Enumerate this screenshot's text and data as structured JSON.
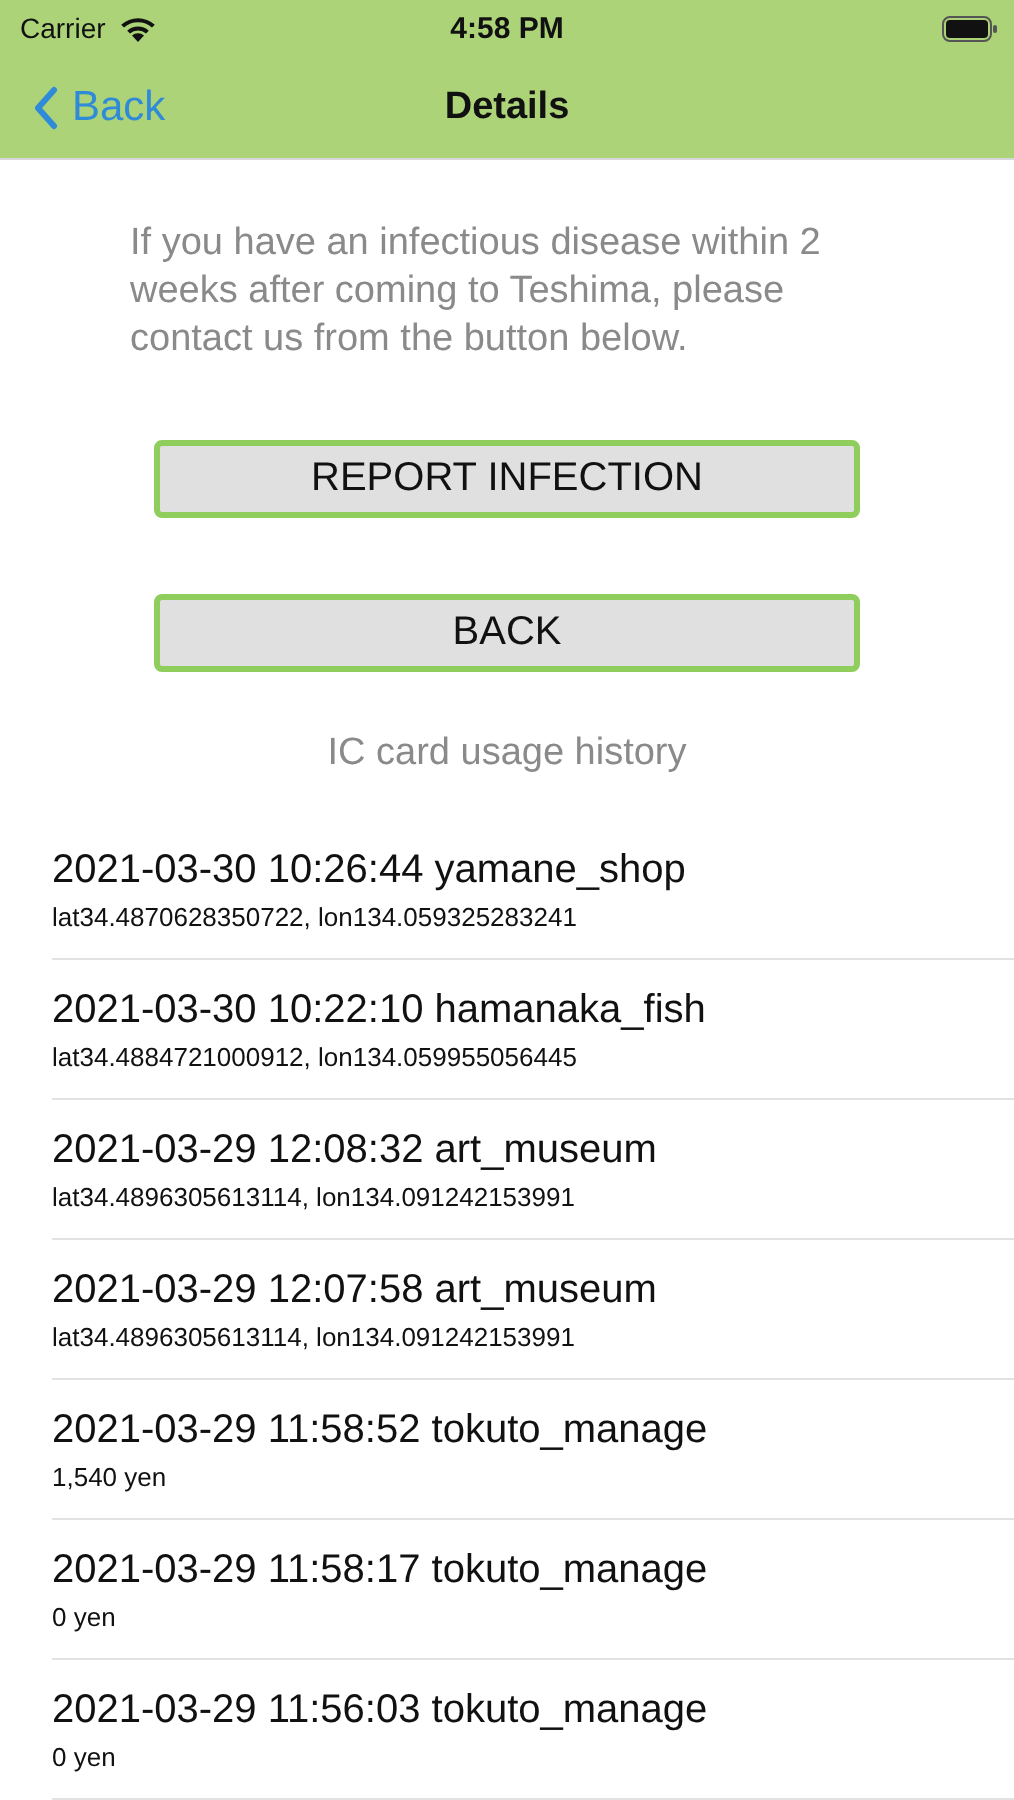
{
  "status_bar": {
    "carrier": "Carrier",
    "time": "4:58 PM"
  },
  "nav": {
    "back": "Back",
    "title": "Details"
  },
  "intro": "If you have an infectious disease within 2 weeks after coming to Teshima, please contact us from the button below.",
  "buttons": [
    "REPORT INFECTION",
    "BACK"
  ],
  "history": {
    "title": "IC card usage history",
    "rows": [
      {
        "title": "2021-03-30 10:26:44 yamane_shop",
        "detail": "lat34.4870628350722, lon134.059325283241"
      },
      {
        "title": "2021-03-30 10:22:10 hamanaka_fish",
        "detail": "lat34.4884721000912, lon134.059955056445"
      },
      {
        "title": "2021-03-29 12:08:32 art_museum",
        "detail": "lat34.4896305613114, lon134.091242153991"
      },
      {
        "title": "2021-03-29 12:07:58 art_museum",
        "detail": "lat34.4896305613114, lon134.091242153991"
      },
      {
        "title": "2021-03-29 11:58:52 tokuto_manage",
        "detail": "1,540 yen"
      },
      {
        "title": "2021-03-29 11:58:17 tokuto_manage",
        "detail": "0 yen"
      },
      {
        "title": "2021-03-29 11:56:03 tokuto_manage",
        "detail": "0 yen"
      }
    ]
  }
}
